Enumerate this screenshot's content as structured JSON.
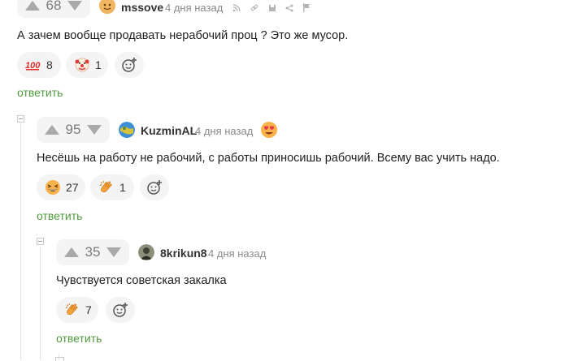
{
  "comments": [
    {
      "score": "68",
      "author": "mssove",
      "date": "4 дня назад",
      "text": "А зачем вообще продавать нерабочий проц ? Это же мусор.",
      "reactions": [
        {
          "icon": "hundred-points-icon",
          "count": "8"
        },
        {
          "icon": "clown-face-icon",
          "count": "1"
        }
      ],
      "reply_label": "ответить",
      "meta_icons": [
        "rss-icon",
        "link-icon",
        "save-icon",
        "share-icon",
        "flag-icon"
      ]
    },
    {
      "score": "95",
      "author": "KuzminAL",
      "date": "4 дня назад",
      "badge_icon": "heart-eyes-icon",
      "text": "Несёшь на работу не рабочий, с работы приносишь рабочий. Всему вас учить надо.",
      "reactions": [
        {
          "icon": "grinning-squint-icon",
          "count": "27"
        },
        {
          "icon": "clapping-hands-icon",
          "count": "1"
        }
      ],
      "reply_label": "ответить"
    },
    {
      "score": "35",
      "author": "8krikun8",
      "date": "4 дня назад",
      "text": "Чувствуется советская закалка",
      "reactions": [
        {
          "icon": "clapping-hands-icon",
          "count": "7"
        }
      ],
      "reply_label": "ответить"
    }
  ],
  "colors": {
    "reply": "#4f9a3d",
    "pill_bg": "#f4f4f4",
    "arrow": "#a9a9a9"
  }
}
